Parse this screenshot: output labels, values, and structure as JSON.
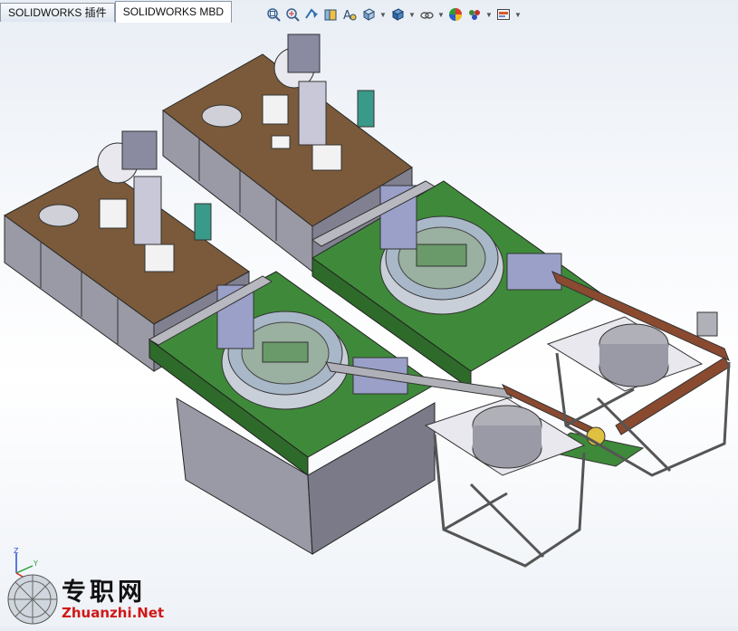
{
  "tabs": [
    {
      "label": "SOLIDWORKS 插件"
    },
    {
      "label": "SOLIDWORKS MBD"
    }
  ],
  "toolbar": {
    "icons": [
      "zoom-to-fit-icon",
      "zoom-to-area-icon",
      "previous-view-icon",
      "section-view-icon",
      "dynamic-annotation-icon",
      "view-orientation-icon",
      "display-style-icon",
      "hide-show-items-icon",
      "edit-appearance-icon",
      "apply-scene-icon",
      "view-settings-icon"
    ]
  },
  "watermark": {
    "cn": "专职网",
    "en": "Zhuanzhi.Net"
  },
  "triad_axes": [
    "Z",
    "Y",
    "X"
  ],
  "colors": {
    "machine_green": "#3f8a3a",
    "cabinet_grey": "#9a9aa6",
    "table_brown": "#7a5a3a",
    "frame_blue": "#9aa0c8",
    "conveyor_rust": "#8a4a30",
    "watermark_red": "#d01818"
  }
}
